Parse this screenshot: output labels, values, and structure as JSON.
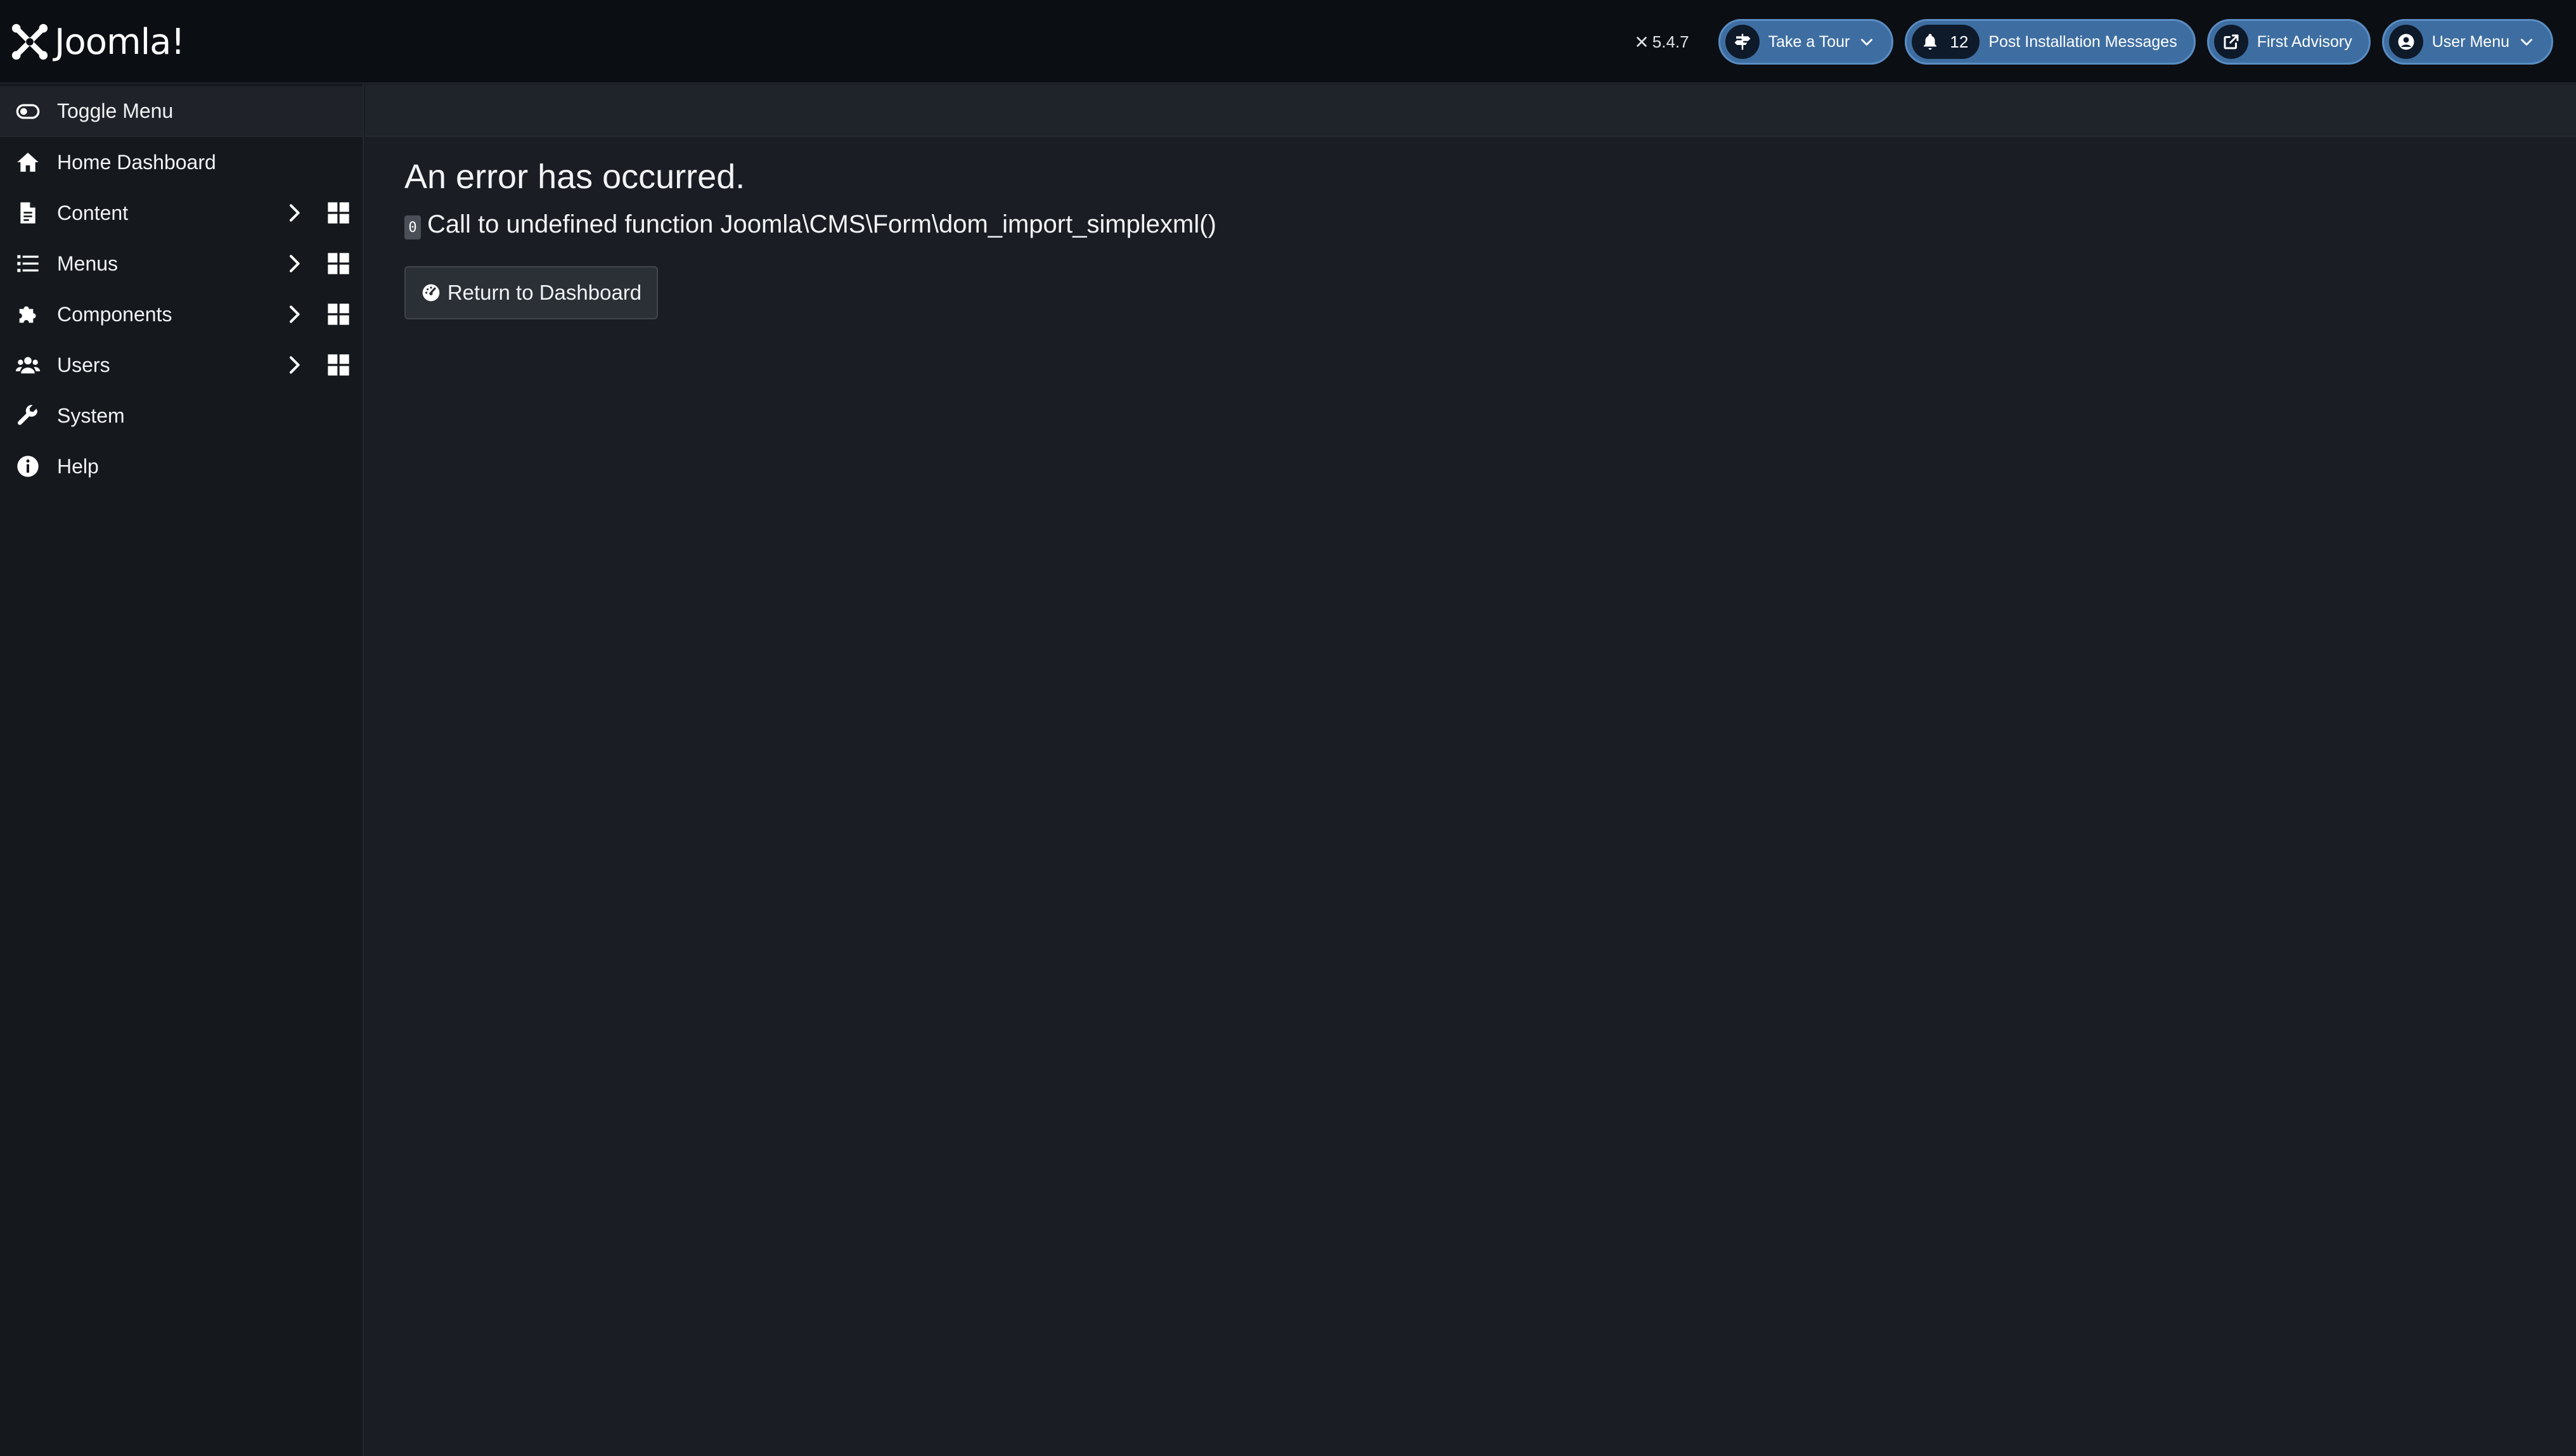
{
  "header": {
    "brand_name": "Joomla!",
    "version": "5.4.7",
    "take_tour_label": "Take a Tour",
    "post_install_count": "12",
    "post_install_label": "Post Installation Messages",
    "first_advisory_label": "First Advisory",
    "user_menu_label": "User Menu"
  },
  "sidebar": {
    "toggle_label": "Toggle Menu",
    "items": [
      {
        "label": "Home Dashboard",
        "icon": "home-icon",
        "submenu": false
      },
      {
        "label": "Content",
        "icon": "file-icon",
        "submenu": true
      },
      {
        "label": "Menus",
        "icon": "list-icon",
        "submenu": true
      },
      {
        "label": "Components",
        "icon": "puzzle-icon",
        "submenu": true
      },
      {
        "label": "Users",
        "icon": "users-icon",
        "submenu": true
      },
      {
        "label": "System",
        "icon": "wrench-icon",
        "submenu": false
      },
      {
        "label": "Help",
        "icon": "info-icon",
        "submenu": false
      }
    ]
  },
  "main": {
    "title": "An error has occurred.",
    "error_code": "0",
    "error_message": "Call to undefined function Joomla\\CMS\\Form\\dom_import_simplexml()",
    "return_label": "Return to Dashboard"
  },
  "colors": {
    "header_bg": "#0b0e13",
    "sidebar_bg": "#15181d",
    "main_bg": "#1a1d23",
    "pill_bg": "#3e6ea1"
  }
}
